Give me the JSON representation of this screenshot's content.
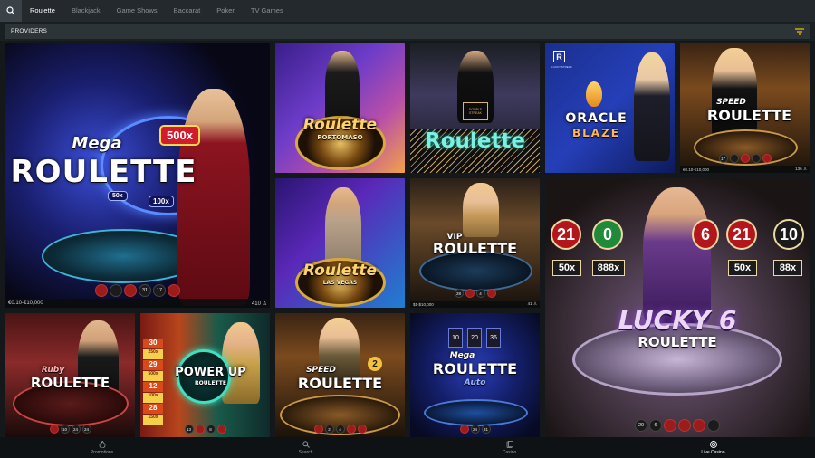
{
  "topnav": {
    "tabs": [
      {
        "label": "Roulette",
        "active": true
      },
      {
        "label": "Blackjack",
        "active": false
      },
      {
        "label": "Game Shows",
        "active": false
      },
      {
        "label": "Baccarat",
        "active": false
      },
      {
        "label": "Poker",
        "active": false
      },
      {
        "label": "TV Games",
        "active": false
      }
    ]
  },
  "providers": {
    "label": "PROVIDERS",
    "filter_icon": "filter-icon",
    "accent": "#f5c400"
  },
  "games": {
    "mega_roulette": {
      "title_line1": "Mega",
      "title_line2": "ROULETTE",
      "mult1": "500x",
      "mult2": "50x",
      "mult3": "100x",
      "limits": "€0.10-€10,000",
      "players": "410",
      "numbers": [
        "",
        "",
        "",
        "31",
        "17",
        ""
      ]
    },
    "roulette_portomaso": {
      "title_line1": "Roulette",
      "title_line2": "PORTOMASO"
    },
    "roulette_classic": {
      "title": "Roulette",
      "badge": "DOUBLE STREAK"
    },
    "oracle_blaze": {
      "brand": "R",
      "sub": "LUCKY STREAK",
      "title_line1": "ORACLE",
      "title_line2": "BLAZE"
    },
    "speed_roulette_top": {
      "title_line1": "SPEED",
      "title_line2": "ROULETTE",
      "limits": "€0.10-€10,000",
      "players": "136",
      "numbers": [
        "17",
        "",
        "",
        "",
        ""
      ]
    },
    "roulette_las_vegas": {
      "title_line1": "Roulette",
      "title_line2": "LAS VEGAS"
    },
    "vip_roulette": {
      "title_line1": "VIP",
      "title_line2": "ROULETTE",
      "limits": "$1-$10,000",
      "players": "41",
      "numbers": [
        "28",
        "",
        "4",
        ""
      ]
    },
    "lucky6": {
      "title_line1": "LUCKY 6",
      "title_line2": "ROULETTE",
      "balls": [
        "21",
        "0",
        "6",
        "21",
        "10"
      ],
      "mults": [
        "50x",
        "888x",
        "",
        "50x",
        "88x"
      ],
      "numbers": [
        "20",
        "6",
        "",
        "",
        "",
        ""
      ]
    },
    "ruby_roulette": {
      "title_line1": "Ruby",
      "title_line2": "ROULETTE",
      "numbers": [
        "",
        "10",
        "24",
        "24"
      ]
    },
    "power_up": {
      "title_line1": "POWER UP",
      "title_line2": "ROULETTE",
      "mults": [
        "30",
        "250x",
        "29",
        "500x",
        "12",
        "100x",
        "28",
        "150x"
      ],
      "numbers": [
        "13",
        "",
        "8",
        ""
      ]
    },
    "speed_roulette_2": {
      "title_line1": "SPEED",
      "title_line2": "ROULETTE",
      "badge": "2",
      "numbers": [
        "",
        "2",
        "4",
        "",
        ""
      ]
    },
    "mega_roulette_auto": {
      "title_line1": "Mega",
      "title_line2": "ROULETTE",
      "title_line3": "Auto",
      "balls": [
        "10",
        "20",
        "36"
      ],
      "numbers": [
        "",
        "24",
        "31"
      ]
    }
  },
  "bottomnav": [
    {
      "label": "Promotions",
      "icon": "flame-icon",
      "active": false
    },
    {
      "label": "Search",
      "icon": "search-icon",
      "active": false
    },
    {
      "label": "Casino",
      "icon": "cards-icon",
      "active": false
    },
    {
      "label": "Live Casino",
      "icon": "chip-icon",
      "active": true
    }
  ]
}
